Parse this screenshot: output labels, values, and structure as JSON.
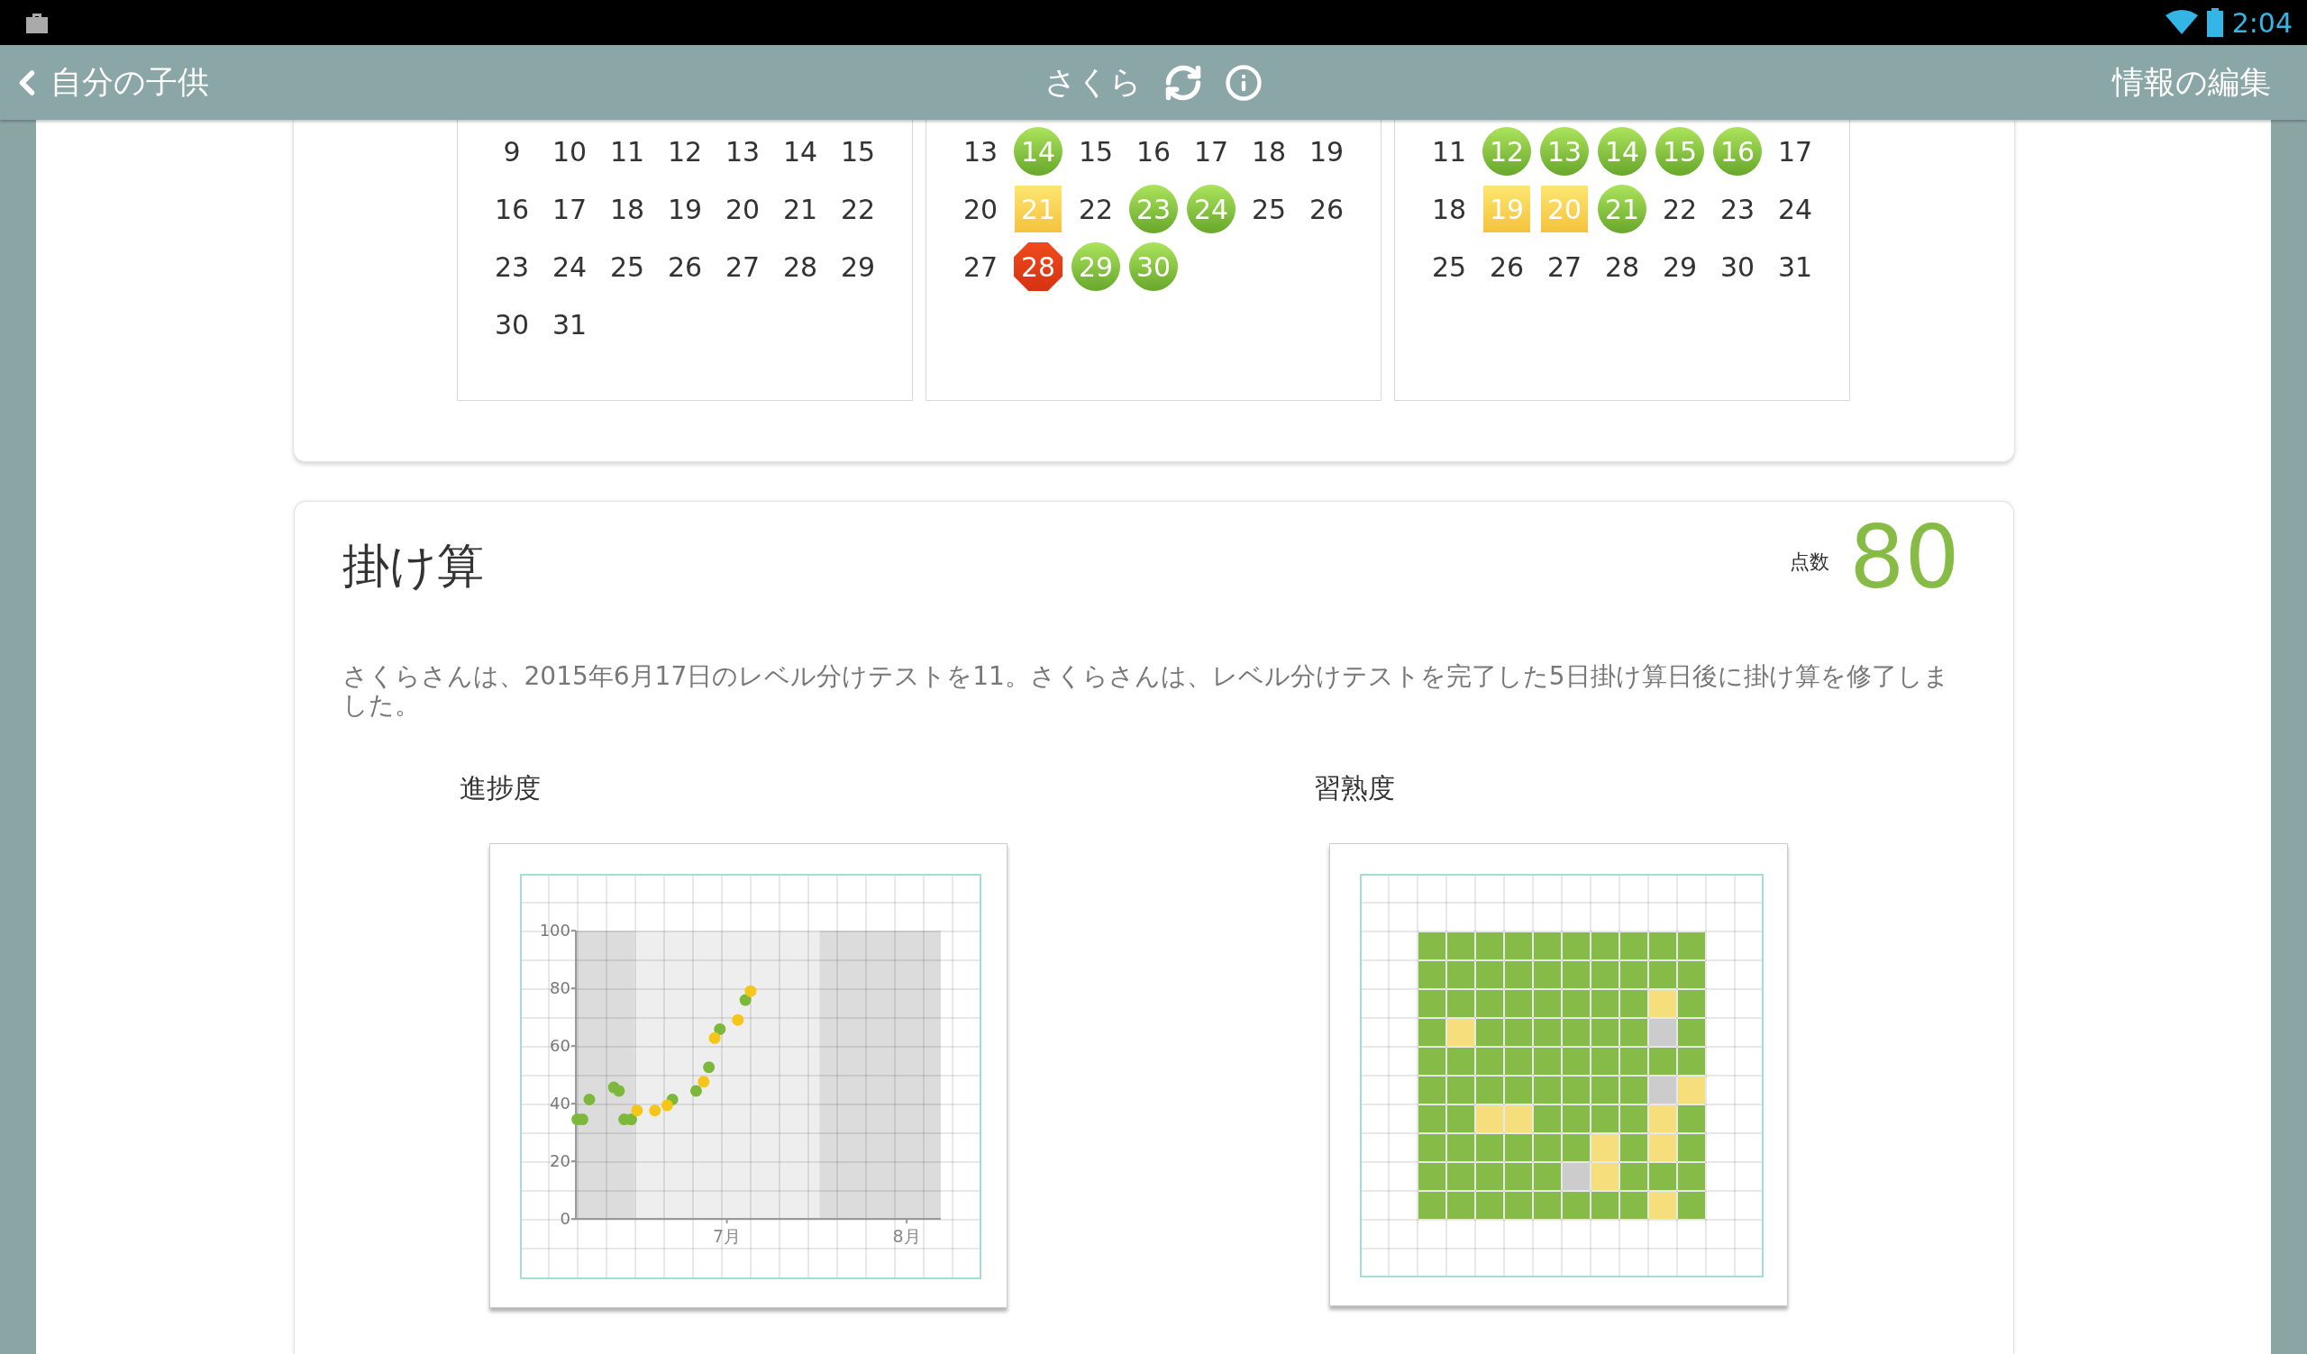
{
  "status_bar": {
    "time": "2:04"
  },
  "nav": {
    "back": "自分の子供",
    "title": "さくら",
    "action": "情報の編集"
  },
  "calendars": [
    {
      "weeks": [
        [
          {
            "day": "9",
            "kind": "plain"
          },
          {
            "day": "10",
            "kind": "plain"
          },
          {
            "day": "11",
            "kind": "plain"
          },
          {
            "day": "12",
            "kind": "plain"
          },
          {
            "day": "13",
            "kind": "plain"
          },
          {
            "day": "14",
            "kind": "plain"
          },
          {
            "day": "15",
            "kind": "plain"
          }
        ],
        [
          {
            "day": "16",
            "kind": "plain"
          },
          {
            "day": "17",
            "kind": "plain"
          },
          {
            "day": "18",
            "kind": "plain"
          },
          {
            "day": "19",
            "kind": "plain"
          },
          {
            "day": "20",
            "kind": "plain"
          },
          {
            "day": "21",
            "kind": "plain"
          },
          {
            "day": "22",
            "kind": "plain"
          }
        ],
        [
          {
            "day": "23",
            "kind": "plain"
          },
          {
            "day": "24",
            "kind": "plain"
          },
          {
            "day": "25",
            "kind": "plain"
          },
          {
            "day": "26",
            "kind": "plain"
          },
          {
            "day": "27",
            "kind": "plain"
          },
          {
            "day": "28",
            "kind": "plain"
          },
          {
            "day": "29",
            "kind": "plain"
          }
        ],
        [
          {
            "day": "30",
            "kind": "plain"
          },
          {
            "day": "31",
            "kind": "plain"
          }
        ]
      ]
    },
    {
      "weeks": [
        [
          {
            "day": "13",
            "kind": "plain"
          },
          {
            "day": "14",
            "kind": "circle"
          },
          {
            "day": "15",
            "kind": "plain"
          },
          {
            "day": "16",
            "kind": "plain"
          },
          {
            "day": "17",
            "kind": "plain"
          },
          {
            "day": "18",
            "kind": "plain"
          },
          {
            "day": "19",
            "kind": "plain"
          }
        ],
        [
          {
            "day": "20",
            "kind": "plain"
          },
          {
            "day": "21",
            "kind": "square"
          },
          {
            "day": "22",
            "kind": "plain"
          },
          {
            "day": "23",
            "kind": "circle"
          },
          {
            "day": "24",
            "kind": "circle"
          },
          {
            "day": "25",
            "kind": "plain"
          },
          {
            "day": "26",
            "kind": "plain"
          }
        ],
        [
          {
            "day": "27",
            "kind": "plain"
          },
          {
            "day": "28",
            "kind": "stop"
          },
          {
            "day": "29",
            "kind": "circle"
          },
          {
            "day": "30",
            "kind": "circle"
          }
        ]
      ]
    },
    {
      "weeks": [
        [
          {
            "day": "11",
            "kind": "plain"
          },
          {
            "day": "12",
            "kind": "circle"
          },
          {
            "day": "13",
            "kind": "circle"
          },
          {
            "day": "14",
            "kind": "circle"
          },
          {
            "day": "15",
            "kind": "circle"
          },
          {
            "day": "16",
            "kind": "circle"
          },
          {
            "day": "17",
            "kind": "plain"
          }
        ],
        [
          {
            "day": "18",
            "kind": "plain"
          },
          {
            "day": "19",
            "kind": "square"
          },
          {
            "day": "20",
            "kind": "square"
          },
          {
            "day": "21",
            "kind": "circle"
          },
          {
            "day": "22",
            "kind": "plain"
          },
          {
            "day": "23",
            "kind": "plain"
          },
          {
            "day": "24",
            "kind": "plain"
          }
        ],
        [
          {
            "day": "25",
            "kind": "plain"
          },
          {
            "day": "26",
            "kind": "plain"
          },
          {
            "day": "27",
            "kind": "plain"
          },
          {
            "day": "28",
            "kind": "plain"
          },
          {
            "day": "29",
            "kind": "plain"
          },
          {
            "day": "30",
            "kind": "plain"
          },
          {
            "day": "31",
            "kind": "plain"
          }
        ]
      ]
    }
  ],
  "lesson": {
    "title": "掛け算",
    "score_label": "点数",
    "score": "80",
    "description": "さくらさんは、2015年6月17日のレベル分けテストを11。さくらさんは、レベル分けテストを完了した5日掛け算日後に掛け算を修了しました。",
    "progress": {
      "title": "進捗度",
      "chart_data": {
        "type": "scatter",
        "xlim": [
          6.16,
          8.19
        ],
        "ylim": [
          0,
          100
        ],
        "yticks": [
          0,
          20,
          40,
          60,
          80,
          100
        ],
        "xticks": [
          {
            "value": 7,
            "label": "7月"
          },
          {
            "value": 8,
            "label": "8月"
          }
        ],
        "x": [
          6.168,
          6.197,
          6.235,
          6.371,
          6.4,
          6.429,
          6.468,
          6.5,
          6.6,
          6.668,
          6.697,
          6.829,
          6.871,
          6.9,
          6.932,
          6.961,
          7.061,
          7.103,
          7.132
        ],
        "series": [
          {
            "color": "#7cb83a",
            "values": [
              34.5,
              34.5,
              41.4,
              45.6,
              44.4,
              34.5,
              34.5,
              null,
              null,
              null,
              41.4,
              44.4,
              null,
              52.6,
              null,
              65.8,
              null,
              75.9,
              null
            ]
          },
          {
            "color": "#f5c518",
            "values": [
              null,
              null,
              null,
              null,
              null,
              null,
              null,
              37.6,
              37.6,
              39.4,
              null,
              null,
              47.6,
              null,
              62.7,
              null,
              69.0,
              null,
              79.0
            ]
          }
        ],
        "grid": true,
        "bands": [
          {
            "axis": "x",
            "from": 6.16,
            "to": 6.484
          },
          {
            "axis": "x",
            "from": 7.516,
            "to": 8.19
          }
        ]
      }
    },
    "mastery": {
      "title": "習熟度",
      "rows": [
        [
          {
            "color": "#86bb48"
          },
          {
            "color": "#86bb48"
          },
          {
            "color": "#86bb48"
          },
          {
            "color": "#86bb48"
          },
          {
            "color": "#86bb48"
          },
          {
            "color": "#86bb48"
          },
          {
            "color": "#86bb48"
          },
          {
            "color": "#86bb48"
          },
          {
            "color": "#86bb48"
          },
          {
            "color": "#86bb48"
          }
        ],
        [
          {
            "color": "#86bb48"
          },
          {
            "color": "#86bb48"
          },
          {
            "color": "#86bb48"
          },
          {
            "color": "#86bb48"
          },
          {
            "color": "#86bb48"
          },
          {
            "color": "#86bb48"
          },
          {
            "color": "#86bb48"
          },
          {
            "color": "#86bb48"
          },
          {
            "color": "#86bb48"
          },
          {
            "color": "#86bb48"
          }
        ],
        [
          {
            "color": "#86bb48"
          },
          {
            "color": "#86bb48"
          },
          {
            "color": "#86bb48"
          },
          {
            "color": "#86bb48"
          },
          {
            "color": "#86bb48"
          },
          {
            "color": "#86bb48"
          },
          {
            "color": "#86bb48"
          },
          {
            "color": "#86bb48"
          },
          {
            "color": "#f4df7c"
          },
          {
            "color": "#86bb48"
          }
        ],
        [
          {
            "color": "#86bb48"
          },
          {
            "color": "#f4df7c"
          },
          {
            "color": "#86bb48"
          },
          {
            "color": "#86bb48"
          },
          {
            "color": "#86bb48"
          },
          {
            "color": "#86bb48"
          },
          {
            "color": "#86bb48"
          },
          {
            "color": "#86bb48"
          },
          {
            "color": "#cccccc"
          },
          {
            "color": "#86bb48"
          }
        ],
        [
          {
            "color": "#86bb48"
          },
          {
            "color": "#86bb48"
          },
          {
            "color": "#86bb48"
          },
          {
            "color": "#86bb48"
          },
          {
            "color": "#86bb48"
          },
          {
            "color": "#86bb48"
          },
          {
            "color": "#86bb48"
          },
          {
            "color": "#86bb48"
          },
          {
            "color": "#86bb48"
          },
          {
            "color": "#86bb48"
          }
        ],
        [
          {
            "color": "#86bb48"
          },
          {
            "color": "#86bb48"
          },
          {
            "color": "#86bb48"
          },
          {
            "color": "#86bb48"
          },
          {
            "color": "#86bb48"
          },
          {
            "color": "#86bb48"
          },
          {
            "color": "#86bb48"
          },
          {
            "color": "#86bb48"
          },
          {
            "color": "#cccccc"
          },
          {
            "color": "#f4df7c"
          }
        ],
        [
          {
            "color": "#86bb48"
          },
          {
            "color": "#86bb48"
          },
          {
            "color": "#f4df7c"
          },
          {
            "color": "#f4df7c"
          },
          {
            "color": "#86bb48"
          },
          {
            "color": "#86bb48"
          },
          {
            "color": "#86bb48"
          },
          {
            "color": "#86bb48"
          },
          {
            "color": "#f4df7c"
          },
          {
            "color": "#86bb48"
          }
        ],
        [
          {
            "color": "#86bb48"
          },
          {
            "color": "#86bb48"
          },
          {
            "color": "#86bb48"
          },
          {
            "color": "#86bb48"
          },
          {
            "color": "#86bb48"
          },
          {
            "color": "#86bb48"
          },
          {
            "color": "#f4df7c"
          },
          {
            "color": "#86bb48"
          },
          {
            "color": "#f4df7c"
          },
          {
            "color": "#86bb48"
          }
        ],
        [
          {
            "color": "#86bb48"
          },
          {
            "color": "#86bb48"
          },
          {
            "color": "#86bb48"
          },
          {
            "color": "#86bb48"
          },
          {
            "color": "#86bb48"
          },
          {
            "color": "#cccccc"
          },
          {
            "color": "#f4df7c"
          },
          {
            "color": "#86bb48"
          },
          {
            "color": "#86bb48"
          },
          {
            "color": "#86bb48"
          }
        ],
        [
          {
            "color": "#86bb48"
          },
          {
            "color": "#86bb48"
          },
          {
            "color": "#86bb48"
          },
          {
            "color": "#86bb48"
          },
          {
            "color": "#86bb48"
          },
          {
            "color": "#86bb48"
          },
          {
            "color": "#86bb48"
          },
          {
            "color": "#86bb48"
          },
          {
            "color": "#f4df7c"
          },
          {
            "color": "#86bb48"
          }
        ]
      ]
    }
  }
}
